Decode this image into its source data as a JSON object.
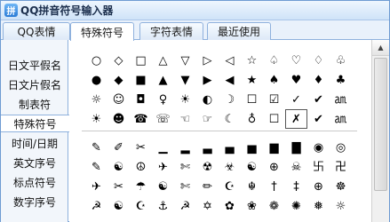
{
  "window": {
    "title": "QQ拼音符号输入器",
    "app_icon": "qq-pinyin-icon"
  },
  "tabs": [
    {
      "label": "QQ表情",
      "active": false
    },
    {
      "label": "特殊符号",
      "active": true
    },
    {
      "label": "字符表情",
      "active": false
    },
    {
      "label": "最近使用",
      "active": false
    }
  ],
  "sidebar": {
    "items": [
      {
        "label": "日文平假名",
        "active": false
      },
      {
        "label": "日文片假名",
        "active": false
      },
      {
        "label": "制表符",
        "active": false
      },
      {
        "label": "特殊符号",
        "active": true
      },
      {
        "label": "时间/日期",
        "active": false
      },
      {
        "label": "英文序号",
        "active": false
      },
      {
        "label": "标点符号",
        "active": false
      },
      {
        "label": "数字序号",
        "active": false
      }
    ]
  },
  "symbols_top": [
    "○",
    "◇",
    "□",
    "△",
    "▽",
    "▷",
    "◁",
    "☆",
    "♤",
    "♡",
    "♢",
    "♧",
    "●",
    "◆",
    "■",
    "▲",
    "▼",
    "▶",
    "◀",
    "★",
    "♠",
    "♥",
    "♦",
    "♣",
    "☼",
    "☺",
    "◘",
    "♀",
    "☀",
    "◐",
    "☽",
    "☐",
    "☑",
    "✓",
    "✔",
    "㏂",
    "☀",
    "☻",
    "☎",
    "☏",
    "☜",
    "☞",
    "☾",
    "♁",
    "☐",
    "✗",
    "✔",
    "㏂"
  ],
  "symbols_bottom": [
    "✎",
    "✐",
    "✂",
    "▁",
    "▂",
    "▃",
    "▄",
    "▅",
    "▆",
    "▇",
    "◉",
    "◎",
    "✎",
    "☯",
    "☮",
    "✈",
    "✄",
    "☢",
    "☣",
    "☯",
    "⊕",
    "☠",
    "卐",
    "卍",
    "✈",
    "✂",
    "☂",
    "☯",
    "✄",
    "✏",
    "☪",
    "☬",
    "†",
    "‡",
    "⊕",
    "☸",
    "☭",
    "☯",
    "☪",
    "⚓",
    "☭",
    "✡",
    "✿",
    "❀",
    "❁",
    "✺",
    "❅",
    "☼"
  ],
  "selected_symbol_index": 45,
  "colors": {
    "accent": "#6e9bd2",
    "tab_bar": "#e9f1fb",
    "sidebar_bg": "#f2f6fb"
  }
}
